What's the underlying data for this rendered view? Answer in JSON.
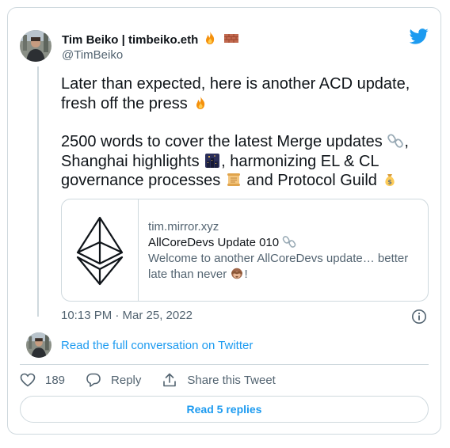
{
  "tweet": {
    "author_name": "Tim Beiko | timbeiko.eth",
    "handle": "@TimBeiko",
    "paragraph1": "Later than expected, here is another ACD update, fresh off the press",
    "p2_a": "2500 words to cover the latest Merge updates",
    "p2_b": ", Shanghai highlights",
    "p2_c": ", harmonizing EL & CL governance processes",
    "p2_d": " and Protocol Guild",
    "timestamp": "10:13 PM · Mar 25, 2022"
  },
  "link_card": {
    "domain": "tim.mirror.xyz",
    "title": "AllCoreDevs Update 010",
    "desc_a": "Welcome to another AllCoreDevs update… better late than never",
    "desc_b": "!"
  },
  "conversation": {
    "label": "Read the full conversation on Twitter"
  },
  "actions": {
    "likes": "189",
    "reply_label": "Reply",
    "share_label": "Share this Tweet"
  },
  "replies_button": {
    "label": "Read 5 replies"
  },
  "icons": [
    "fire-icon",
    "brick-icon",
    "chain-icon",
    "night-city-icon",
    "scroll-icon",
    "money-bag-icon",
    "see-no-evil-monkey-icon",
    "ethereum-logo-icon",
    "twitter-bird-icon",
    "info-icon",
    "heart-icon",
    "reply-icon",
    "share-icon"
  ],
  "colors": {
    "accent": "#1d9bf0",
    "text": "#0f1419",
    "secondary": "#536471",
    "border": "#cfd9de"
  }
}
